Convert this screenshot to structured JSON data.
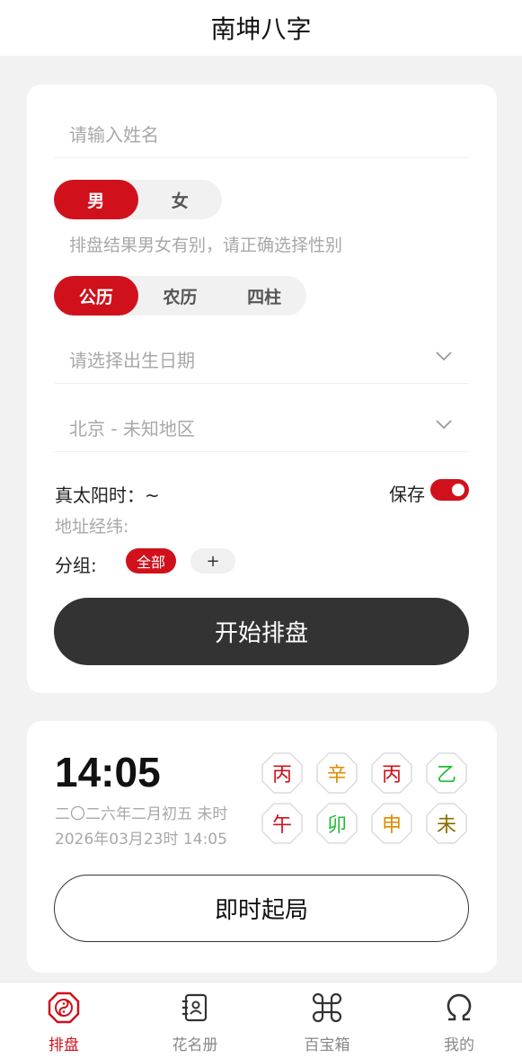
{
  "header": {
    "title": "南坤八字"
  },
  "form": {
    "name_placeholder": "请输入姓名",
    "gender_options": [
      "男",
      "女"
    ],
    "gender_selected": "男",
    "gender_hint": "排盘结果男女有别，请正确选择性别",
    "calendar_options": [
      "公历",
      "农历",
      "四柱"
    ],
    "calendar_selected": "公历",
    "date_placeholder": "请选择出生日期",
    "place_value": "北京 - 未知地区",
    "true_solar_label": "真太阳时：~",
    "save_label": "保存",
    "save_on": true,
    "address_label": "地址经纬:",
    "group_label": "分组:",
    "group_all": "全部",
    "group_add": "+",
    "start_button": "开始排盘"
  },
  "now": {
    "time": "14:05",
    "lunar_date": "二〇二六年二月初五 未时",
    "solar_date": "2026年03月23时 14:05",
    "stems": [
      {
        "char": "丙",
        "color": "#d0111b"
      },
      {
        "char": "辛",
        "color": "#e08a00"
      },
      {
        "char": "丙",
        "color": "#d0111b"
      },
      {
        "char": "乙",
        "color": "#22bb33"
      }
    ],
    "branches": [
      {
        "char": "午",
        "color": "#d0111b"
      },
      {
        "char": "卯",
        "color": "#22bb33"
      },
      {
        "char": "申",
        "color": "#e08a00"
      },
      {
        "char": "未",
        "color": "#8a6d00"
      }
    ],
    "instant_button": "即时起局"
  },
  "tabbar": {
    "items": [
      {
        "label": "排盘",
        "icon": "bagua-icon",
        "active": true
      },
      {
        "label": "花名册",
        "icon": "contacts-icon",
        "active": false
      },
      {
        "label": "百宝箱",
        "icon": "command-icon",
        "active": false
      },
      {
        "label": "我的",
        "icon": "omega-icon",
        "active": false
      }
    ]
  },
  "colors": {
    "accent": "#d0111b",
    "dark_button": "#333333"
  }
}
